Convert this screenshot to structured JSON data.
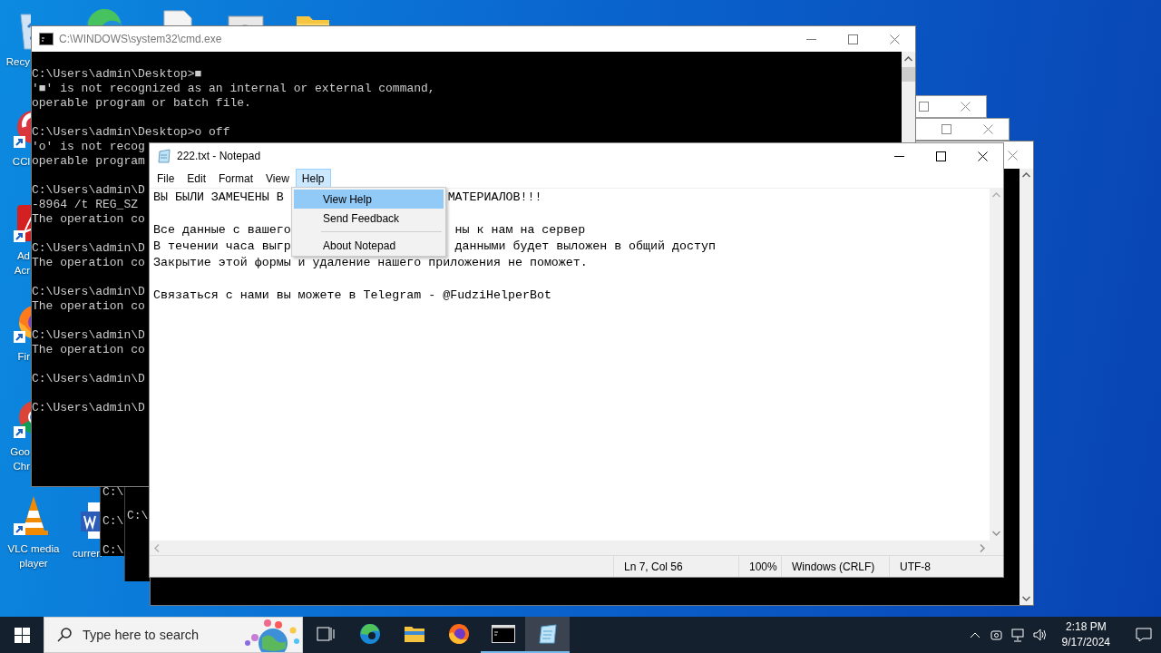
{
  "desktop_icons": [
    {
      "kind": "recycle",
      "label_lines": [
        "Recy"
      ]
    },
    {
      "kind": "ccleaner",
      "label_lines": [
        "CCl"
      ]
    },
    {
      "kind": "acrobat",
      "label_lines": [
        "Ad",
        "Acr"
      ]
    },
    {
      "kind": "firefox",
      "label_lines": [
        "Fir"
      ]
    },
    {
      "kind": "chrome",
      "label_lines": [
        "Goo",
        "Chr"
      ]
    },
    {
      "kind": "vlc",
      "label_lines": [
        "VLC media",
        "player"
      ]
    },
    {
      "kind": "word",
      "label_lines": [
        "curren"
      ]
    },
    {
      "kind": "edge"
    },
    {
      "kind": "file"
    },
    {
      "kind": "panel"
    },
    {
      "kind": "folder"
    }
  ],
  "background_consoles": [
    {
      "lines": [
        "C:\\",
        "C:\\",
        "C:\\"
      ]
    },
    {
      "lines": [
        "C:\\"
      ]
    }
  ],
  "cmd_window": {
    "title": "C:\\WINDOWS\\system32\\cmd.exe",
    "blocks": [
      [
        "C:\\Users\\admin\\Desktop>■",
        "'■' is not recognized as an internal or external command,",
        "operable program or batch file."
      ],
      [
        "C:\\Users\\admin\\Desktop>o off",
        "'o' is not recog",
        "operable program"
      ],
      [
        "C:\\Users\\admin\\D",
        "-8964 /t REG_SZ",
        "The operation co"
      ],
      [
        "C:\\Users\\admin\\D",
        "The operation co"
      ],
      [
        "C:\\Users\\admin\\D",
        "The operation co"
      ],
      [
        "C:\\Users\\admin\\D",
        "The operation co"
      ],
      [
        "C:\\Users\\admin\\D"
      ],
      [
        "C:\\Users\\admin\\D"
      ]
    ]
  },
  "notepad": {
    "title": "222.txt - Notepad",
    "menu": [
      {
        "label": "File",
        "selected": false
      },
      {
        "label": "Edit",
        "selected": false
      },
      {
        "label": "Format",
        "selected": false
      },
      {
        "label": "View",
        "selected": false
      },
      {
        "label": "Help",
        "selected": true
      }
    ],
    "help_menu": [
      {
        "kind": "item",
        "label": "View Help",
        "selected": true
      },
      {
        "kind": "item",
        "label": "Send Feedback",
        "selected": false
      },
      {
        "kind": "separator"
      },
      {
        "kind": "item",
        "label": "About Notepad",
        "selected": false
      }
    ],
    "blocks": [
      [
        {
          "left": "ВЫ БЫЛИ ЗАМЕЧЕНЫ В",
          "right": "МАТЕРИАЛОВ!!!"
        }
      ],
      [
        {
          "left": "Все данные с вашего",
          "right": "ны к нам на сервер"
        },
        {
          "left": "В течении часа выгр",
          "right": "данными будет выложен в общий доступ"
        },
        {
          "left": "Закрытие этой формы и удаление нашего приложения не поможет."
        }
      ],
      [
        {
          "left": "Связаться с нами вы можете в Telegram - @FudziHelperBot"
        }
      ]
    ],
    "status_bar": [
      "Ln 7, Col 56",
      "100%",
      "Windows (CRLF)",
      "UTF-8"
    ]
  },
  "taskbar": {
    "search": {
      "placeholder": "Type here to search"
    },
    "apps": [
      {
        "kind": "taskview",
        "running": false,
        "selected": false
      },
      {
        "kind": "edge",
        "running": false,
        "selected": false
      },
      {
        "kind": "explorer",
        "running": false,
        "selected": false
      },
      {
        "kind": "firefox",
        "running": false,
        "selected": false
      },
      {
        "kind": "terminal",
        "running": true,
        "selected": false
      },
      {
        "kind": "notepad",
        "running": true,
        "selected": true
      }
    ],
    "clock": {
      "time": "2:18 PM",
      "date": "9/17/2024"
    }
  }
}
